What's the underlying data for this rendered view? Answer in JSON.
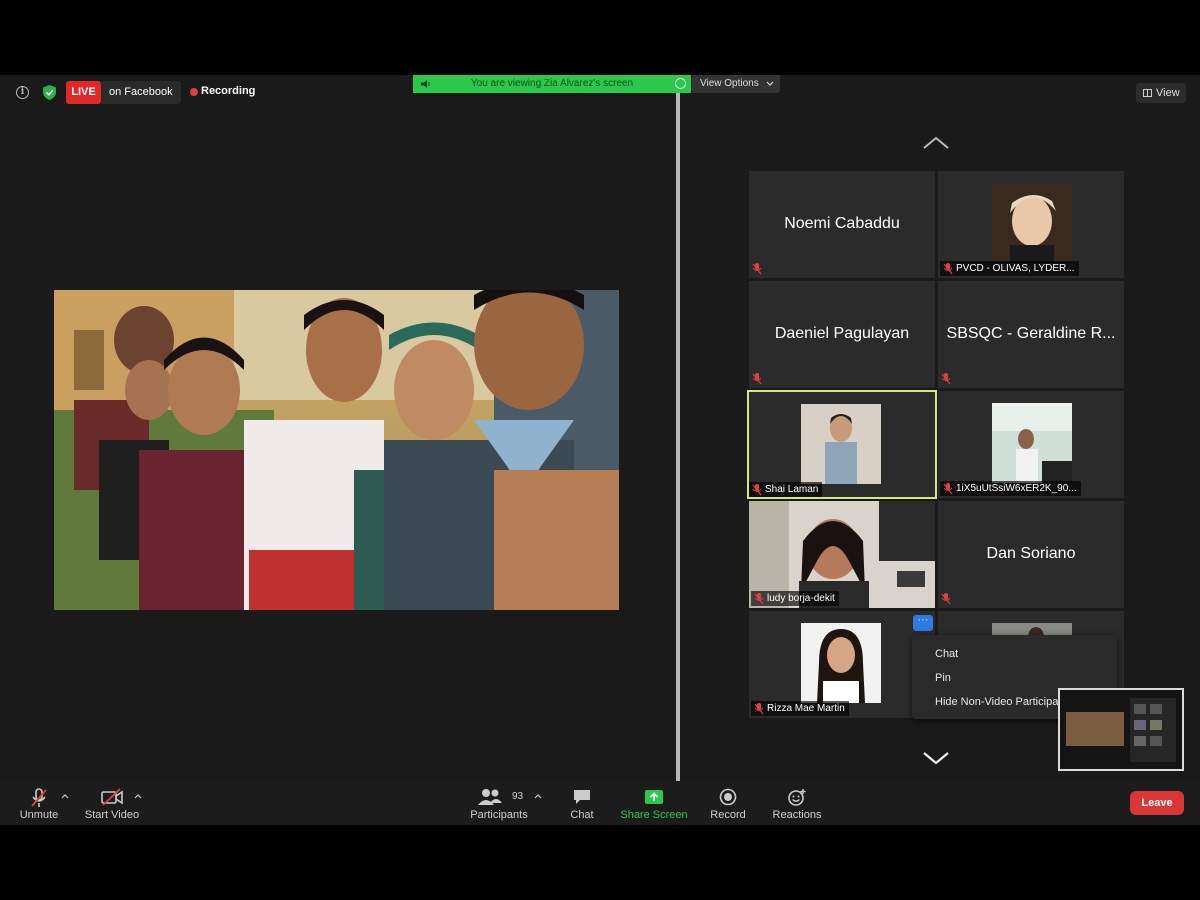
{
  "topbar": {
    "live_label": "LIVE",
    "live_destination": "on Facebook",
    "recording_label": "Recording",
    "viewing_banner": "You are viewing Zia Alvarez's screen",
    "view_options_label": "View Options",
    "view_button_label": "View"
  },
  "gallery": {
    "tiles": [
      {
        "name": "Noemi Cabaddu",
        "video": false
      },
      {
        "name": "PVCD - OLIVAS, LYDER...",
        "video": true
      },
      {
        "name": "Daeniel Pagulayan",
        "video": false
      },
      {
        "name": "SBSQC - Geraldine R...",
        "video": false
      },
      {
        "name": "Shai Laman",
        "video": true,
        "active": true
      },
      {
        "name": "1iX5uUtSsiW6xER2K_90...",
        "video": true
      },
      {
        "name": "ludy borja-dekit",
        "video": true
      },
      {
        "name": "Dan Soriano",
        "video": false
      },
      {
        "name": "Rizza Mae Martin",
        "video": true
      }
    ],
    "more_label": "···"
  },
  "context_menu": {
    "items": [
      "Chat",
      "Pin",
      "Hide Non-Video Participants"
    ]
  },
  "toolbar": {
    "unmute_label": "Unmute",
    "start_video_label": "Start Video",
    "participants_label": "Participants",
    "participants_count": "93",
    "chat_label": "Chat",
    "share_screen_label": "Share Screen",
    "record_label": "Record",
    "reactions_label": "Reactions",
    "leave_label": "Leave"
  },
  "colors": {
    "live_red": "#e02828",
    "share_green": "#2bc84b",
    "leave_red": "#d93636",
    "active_border": "#d7e87a",
    "more_blue": "#2d7be5"
  }
}
